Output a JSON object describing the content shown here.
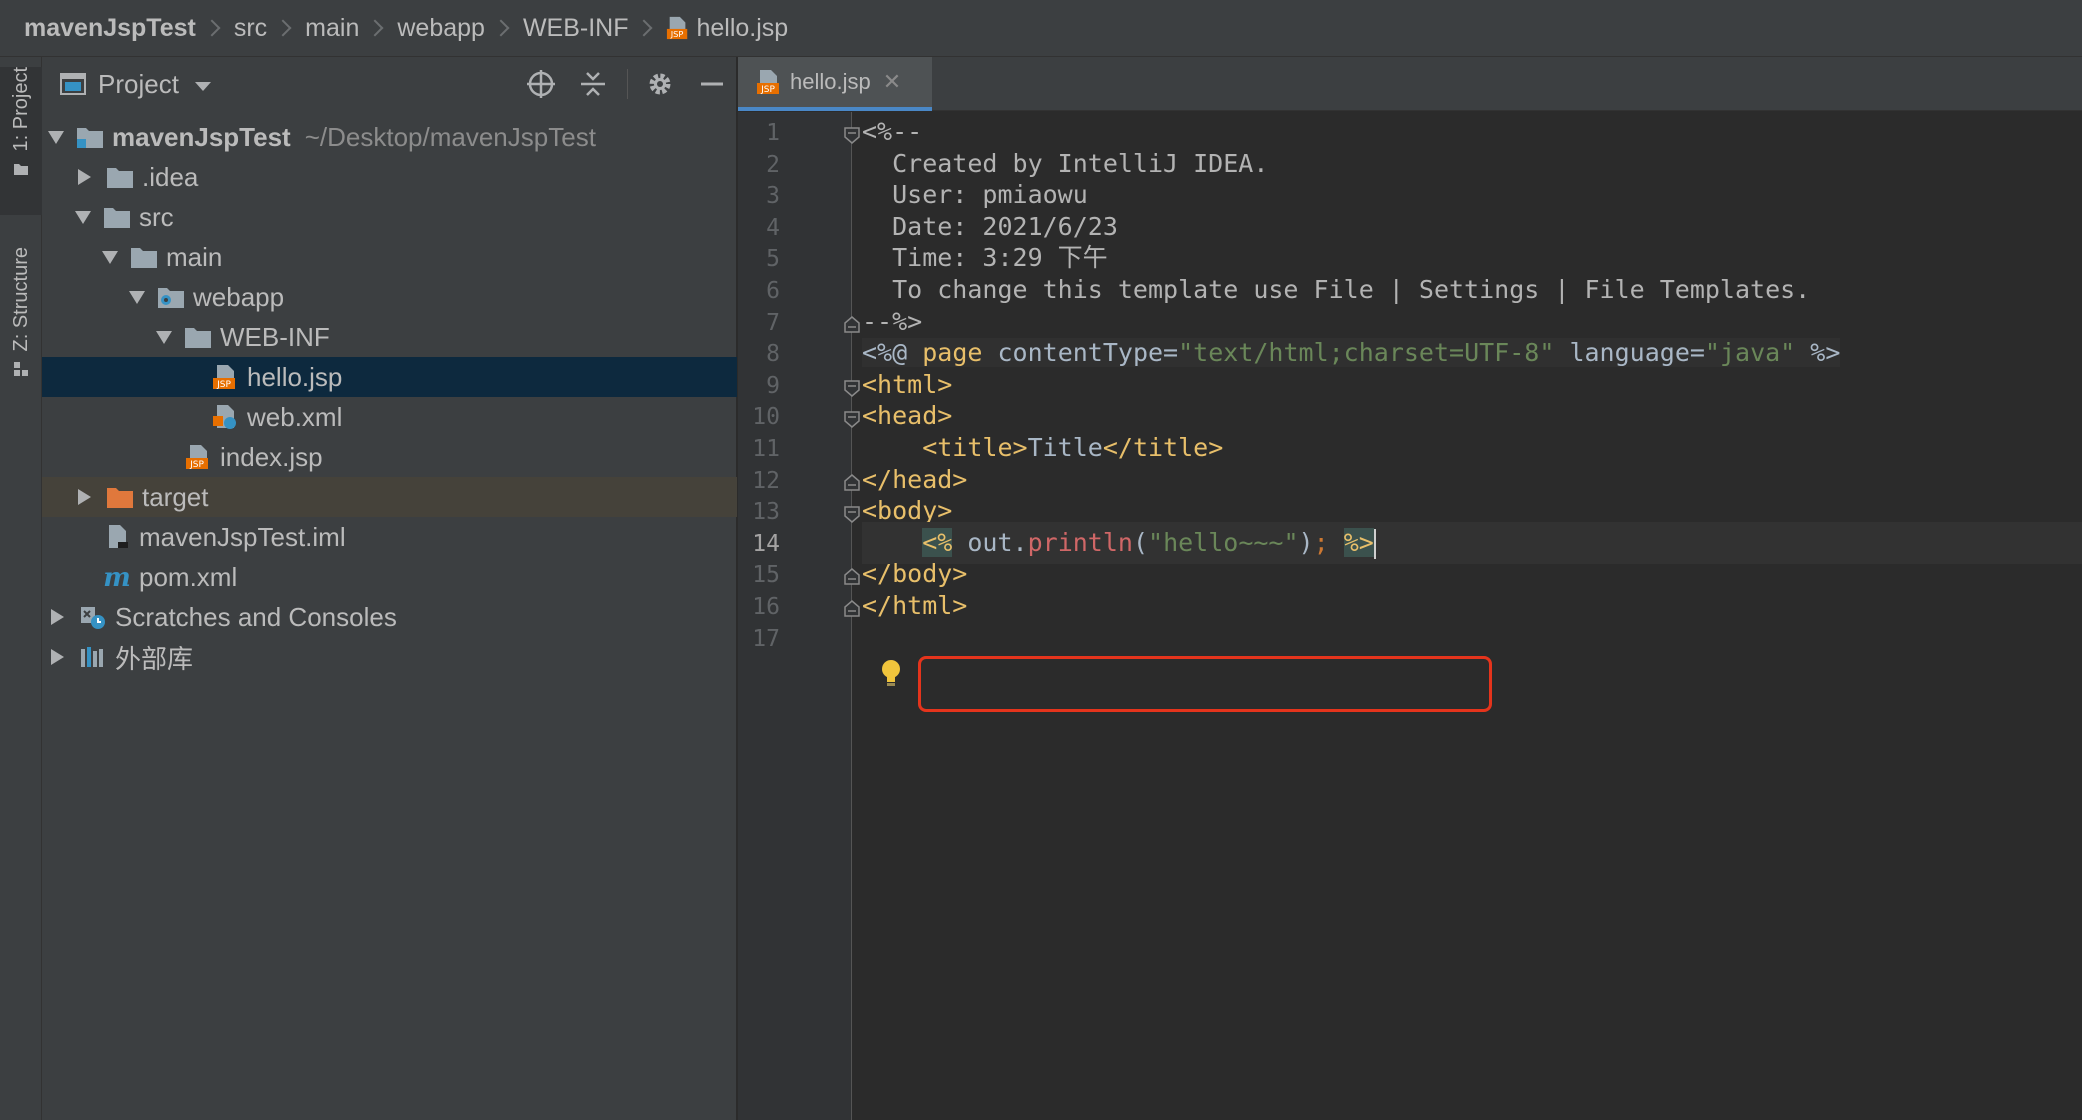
{
  "breadcrumb": [
    "mavenJspTest",
    "src",
    "main",
    "webapp",
    "WEB-INF",
    "hello.jsp"
  ],
  "tool_windows": {
    "project_tab": "1: Project",
    "structure_tab": "Z: Structure"
  },
  "project_panel": {
    "title": "Project",
    "tree": [
      {
        "label": "mavenJspTest",
        "hint": "~/Desktop/mavenJspTest",
        "level": 0,
        "arrow": "down",
        "icon": "module-folder-icon"
      },
      {
        "label": ".idea",
        "level": 1,
        "arrow": "right",
        "icon": "folder-icon"
      },
      {
        "label": "src",
        "level": 1,
        "arrow": "down",
        "icon": "folder-icon"
      },
      {
        "label": "main",
        "level": 2,
        "arrow": "down",
        "icon": "folder-icon"
      },
      {
        "label": "webapp",
        "level": 3,
        "arrow": "down",
        "icon": "web-folder-icon"
      },
      {
        "label": "WEB-INF",
        "level": 4,
        "arrow": "down",
        "icon": "folder-icon"
      },
      {
        "label": "hello.jsp",
        "level": 5,
        "arrow": "none",
        "icon": "jsp-file-icon",
        "selected": true
      },
      {
        "label": "web.xml",
        "level": 5,
        "arrow": "none",
        "icon": "web-xml-icon"
      },
      {
        "label": "index.jsp",
        "level": 4,
        "arrow": "none",
        "icon": "jsp-file-icon"
      },
      {
        "label": "target",
        "level": 1,
        "arrow": "right",
        "icon": "excluded-folder-icon",
        "excluded": true
      },
      {
        "label": "mavenJspTest.iml",
        "level": 1,
        "arrow": "none",
        "icon": "iml-file-icon"
      },
      {
        "label": "pom.xml",
        "level": 1,
        "arrow": "none",
        "icon": "maven-icon"
      },
      {
        "label": "Scratches and Consoles",
        "level": 0,
        "arrow": "right",
        "icon": "scratches-icon"
      },
      {
        "label": "外部库",
        "level": 0,
        "arrow": "right",
        "icon": "libraries-icon"
      }
    ]
  },
  "editor": {
    "tab_label": "hello.jsp",
    "current_line": 14,
    "lines": [
      {
        "n": "1",
        "fold": "open",
        "segs": [
          {
            "t": "<%--",
            "c": "c-comment"
          }
        ]
      },
      {
        "n": "2",
        "segs": [
          {
            "t": "  Created by IntelliJ IDEA.",
            "c": "c-comment"
          }
        ]
      },
      {
        "n": "3",
        "segs": [
          {
            "t": "  User: pmiaowu",
            "c": "c-comment"
          }
        ]
      },
      {
        "n": "4",
        "segs": [
          {
            "t": "  Date: 2021/6/23",
            "c": "c-comment"
          }
        ]
      },
      {
        "n": "5",
        "segs": [
          {
            "t": "  Time: 3:29 下午",
            "c": "c-comment"
          }
        ]
      },
      {
        "n": "6",
        "segs": [
          {
            "t": "  To change this template use File | Settings | File Templates.",
            "c": "c-comment"
          }
        ]
      },
      {
        "n": "7",
        "fold": "close",
        "segs": [
          {
            "t": "--%>",
            "c": "c-comment"
          }
        ]
      },
      {
        "n": "8",
        "directive": true,
        "segs": [
          {
            "t": "<%@ ",
            "c": "c-text"
          },
          {
            "t": "page ",
            "c": "c-tag"
          },
          {
            "t": "contentType=",
            "c": "c-text"
          },
          {
            "t": "\"text/html;charset=UTF-8\"",
            "c": "c-str"
          },
          {
            "t": " language=",
            "c": "c-text"
          },
          {
            "t": "\"java\"",
            "c": "c-str"
          },
          {
            "t": " %>",
            "c": "c-text"
          }
        ]
      },
      {
        "n": "9",
        "fold": "open",
        "segs": [
          {
            "t": "<html>",
            "c": "c-tag"
          }
        ]
      },
      {
        "n": "10",
        "fold": "open",
        "segs": [
          {
            "t": "<head>",
            "c": "c-tag"
          }
        ]
      },
      {
        "n": "11",
        "segs": [
          {
            "t": "    <title>",
            "c": "c-tag"
          },
          {
            "t": "Title",
            "c": "c-text"
          },
          {
            "t": "</title>",
            "c": "c-tag"
          }
        ]
      },
      {
        "n": "12",
        "fold": "close",
        "segs": [
          {
            "t": "</head>",
            "c": "c-tag"
          }
        ]
      },
      {
        "n": "13",
        "fold": "open",
        "segs": [
          {
            "t": "<body>",
            "c": "c-tag"
          }
        ]
      },
      {
        "n": "14",
        "segs": [
          {
            "t": "    ",
            "c": "c-text"
          },
          {
            "t": "<%",
            "c": "c-jsp"
          },
          {
            "t": " out.",
            "c": "c-text"
          },
          {
            "t": "println",
            "c": "c-pmeth"
          },
          {
            "t": "(",
            "c": "c-text"
          },
          {
            "t": "\"hello~~~\"",
            "c": "c-str"
          },
          {
            "t": ")",
            "c": "c-text"
          },
          {
            "t": "; ",
            "c": "c-semi"
          },
          {
            "t": "%>",
            "c": "c-jsp"
          }
        ]
      },
      {
        "n": "15",
        "fold": "close",
        "segs": [
          {
            "t": "</body>",
            "c": "c-tag"
          }
        ]
      },
      {
        "n": "16",
        "fold": "close",
        "segs": [
          {
            "t": "</html>",
            "c": "c-tag"
          }
        ]
      },
      {
        "n": "17",
        "segs": []
      }
    ]
  },
  "colors": {
    "accent_tab": "#4a88c7",
    "highlight_box": "#e5341c",
    "selection": "#0d293e"
  }
}
